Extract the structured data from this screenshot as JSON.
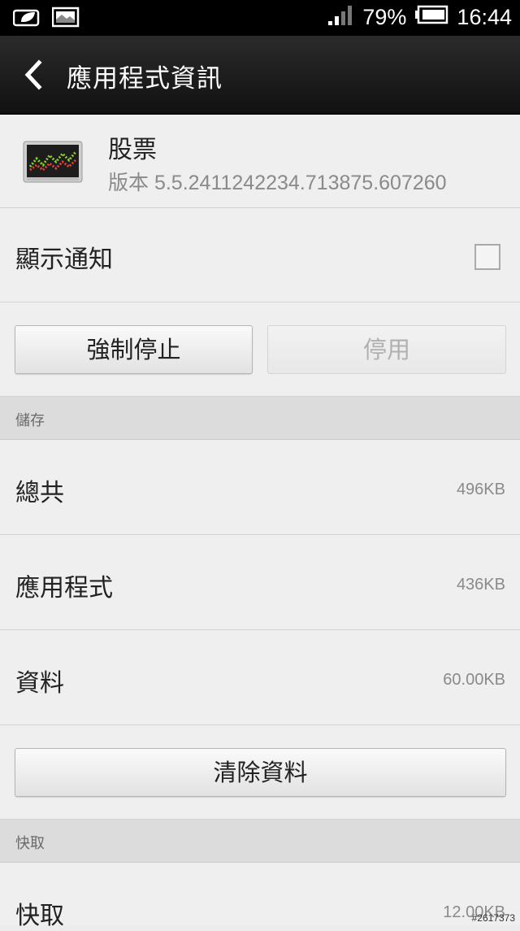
{
  "status_bar": {
    "battery_percent": "79%",
    "time": "16:44",
    "icons": [
      "leaf-notification-icon",
      "image-notification-icon",
      "signal-icon",
      "battery-icon"
    ]
  },
  "action_bar": {
    "title": "應用程式資訊",
    "back_icon": "chevron-left-icon"
  },
  "app": {
    "name": "股票",
    "version": "版本 5.5.2411242234.713875.607260",
    "icon": "stocks-app-icon"
  },
  "notification": {
    "label": "顯示通知",
    "checked": false
  },
  "buttons": {
    "force_stop": "強制停止",
    "disable": "停用",
    "clear_data": "清除資料"
  },
  "storage": {
    "header": "儲存",
    "rows": [
      {
        "label": "總共",
        "value": "496KB"
      },
      {
        "label": "應用程式",
        "value": "436KB"
      },
      {
        "label": "資料",
        "value": "60.00KB"
      }
    ]
  },
  "cache": {
    "header": "快取",
    "rows": [
      {
        "label": "快取",
        "value": "12.00KB"
      }
    ]
  },
  "watermark": "#2617373",
  "colors": {
    "action_bar": "#1a1a1a",
    "background": "#ececec",
    "section_header": "#dcdcdc"
  }
}
